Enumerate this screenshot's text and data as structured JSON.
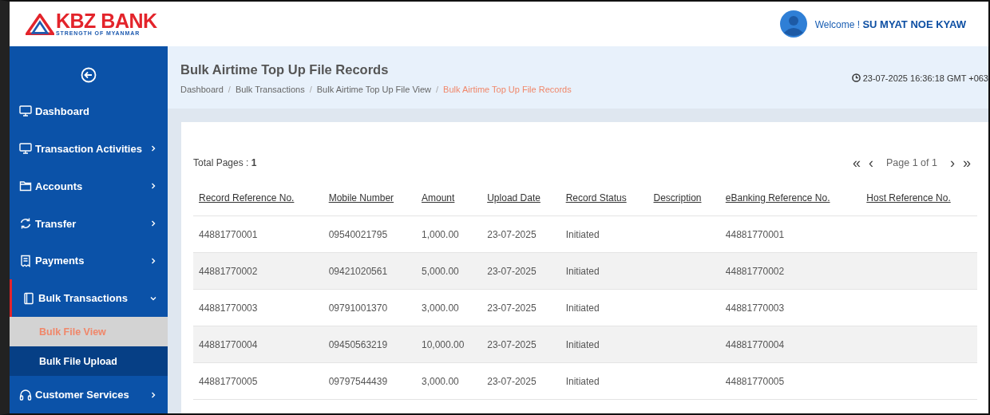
{
  "logo": {
    "name": "KBZ BANK",
    "tagline": "STRENGTH OF MYANMAR"
  },
  "user": {
    "greeting": "Welcome !",
    "name": "SU MYAT NOE KYAW"
  },
  "sidebar": {
    "items": [
      {
        "label": "Dashboard",
        "has_arrow": false,
        "active": false
      },
      {
        "label": "Transaction Activities",
        "has_arrow": true,
        "expanded": false,
        "active": false
      },
      {
        "label": "Accounts",
        "has_arrow": true,
        "expanded": false,
        "active": false
      },
      {
        "label": "Transfer",
        "has_arrow": true,
        "expanded": false,
        "active": false
      },
      {
        "label": "Payments",
        "has_arrow": true,
        "expanded": false,
        "active": false
      },
      {
        "label": "Bulk Transactions",
        "has_arrow": true,
        "expanded": true,
        "active": true,
        "children": [
          {
            "label": "Bulk File View",
            "selected": true
          },
          {
            "label": "Bulk File Upload",
            "selected": false
          }
        ]
      },
      {
        "label": "Customer Services",
        "has_arrow": true,
        "expanded": false,
        "active": false
      }
    ]
  },
  "page": {
    "title": "Bulk Airtime Top Up File Records",
    "datetime": "23-07-2025 16:36:18 GMT +063",
    "breadcrumb_separator": "/",
    "breadcrumb": [
      {
        "label": "Dashboard",
        "current": false
      },
      {
        "label": "Bulk Transactions",
        "current": false
      },
      {
        "label": "Bulk Airtime Top Up File View",
        "current": false
      },
      {
        "label": "Bulk Airtime Top Up File Records",
        "current": true
      }
    ]
  },
  "pagination": {
    "total_label": "Total Pages :",
    "total": "1",
    "first": "«",
    "prev": "‹",
    "page_label": "Page 1 of 1",
    "next": "›",
    "last": "»"
  },
  "table": {
    "columns": [
      "Record Reference No.",
      "Mobile Number",
      "Amount",
      "Upload Date",
      "Record Status",
      "Description",
      "eBanking Reference No.",
      "Host Reference No."
    ],
    "rows": [
      [
        "44881770001",
        "09540021795",
        "1,000.00",
        "23-07-2025",
        "Initiated",
        "",
        "44881770001",
        ""
      ],
      [
        "44881770002",
        "09421020561",
        "5,000.00",
        "23-07-2025",
        "Initiated",
        "",
        "44881770002",
        ""
      ],
      [
        "44881770003",
        "09791001370",
        "3,000.00",
        "23-07-2025",
        "Initiated",
        "",
        "44881770003",
        ""
      ],
      [
        "44881770004",
        "09450563219",
        "10,000.00",
        "23-07-2025",
        "Initiated",
        "",
        "44881770004",
        ""
      ],
      [
        "44881770005",
        "09797544439",
        "3,000.00",
        "23-07-2025",
        "Initiated",
        "",
        "44881770005",
        ""
      ]
    ]
  }
}
